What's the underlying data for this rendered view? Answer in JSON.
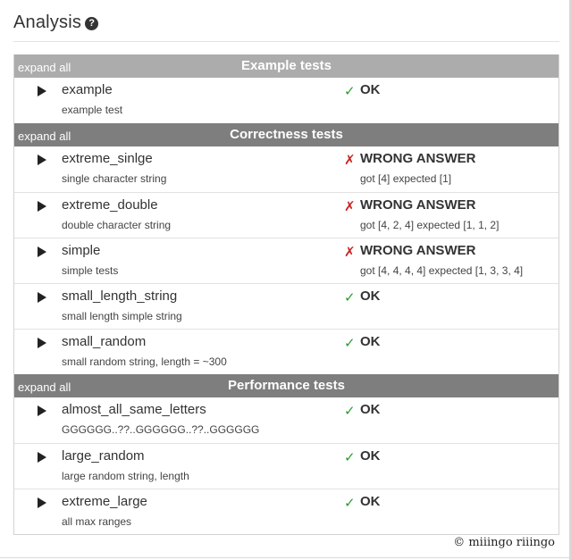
{
  "page": {
    "title": "Analysis",
    "help_symbol": "?"
  },
  "colors": {
    "header_light": "#acacac",
    "header_dark": "#7e7e7e",
    "ok": "#2e9d2e",
    "fail": "#cc2222"
  },
  "groups": [
    {
      "expand_label": "expand all",
      "title": "Example tests",
      "tests": [
        {
          "name": "example",
          "description": "example test",
          "status": "OK",
          "ok": true,
          "detail": ""
        }
      ]
    },
    {
      "expand_label": "expand all",
      "title": "Correctness tests",
      "tests": [
        {
          "name": "extreme_sinlge",
          "description": "single character string",
          "status": "WRONG ANSWER",
          "ok": false,
          "detail": "got [4] expected [1]"
        },
        {
          "name": "extreme_double",
          "description": "double character string",
          "status": "WRONG ANSWER",
          "ok": false,
          "detail": "got [4, 2, 4] expected [1, 1, 2]"
        },
        {
          "name": "simple",
          "description": "simple tests",
          "status": "WRONG ANSWER",
          "ok": false,
          "detail": "got [4, 4, 4, 4] expected [1, 3, 3, 4]"
        },
        {
          "name": "small_length_string",
          "description": "small length simple string",
          "status": "OK",
          "ok": true,
          "detail": ""
        },
        {
          "name": "small_random",
          "description": "small random string, length = ~300",
          "status": "OK",
          "ok": true,
          "detail": ""
        }
      ]
    },
    {
      "expand_label": "expand all",
      "title": "Performance tests",
      "tests": [
        {
          "name": "almost_all_same_letters",
          "description": "GGGGGG..??..GGGGGG..??..GGGGGG",
          "status": "OK",
          "ok": true,
          "detail": ""
        },
        {
          "name": "large_random",
          "description": "large random string, length",
          "status": "OK",
          "ok": true,
          "detail": ""
        },
        {
          "name": "extreme_large",
          "description": "all max ranges",
          "status": "OK",
          "ok": true,
          "detail": ""
        }
      ]
    }
  ],
  "icons": {
    "ok_symbol": "✓",
    "fail_symbol": "✗",
    "expand_icon": "triangle-right"
  },
  "footer": {
    "watermark": "© miiingo riiingo"
  }
}
